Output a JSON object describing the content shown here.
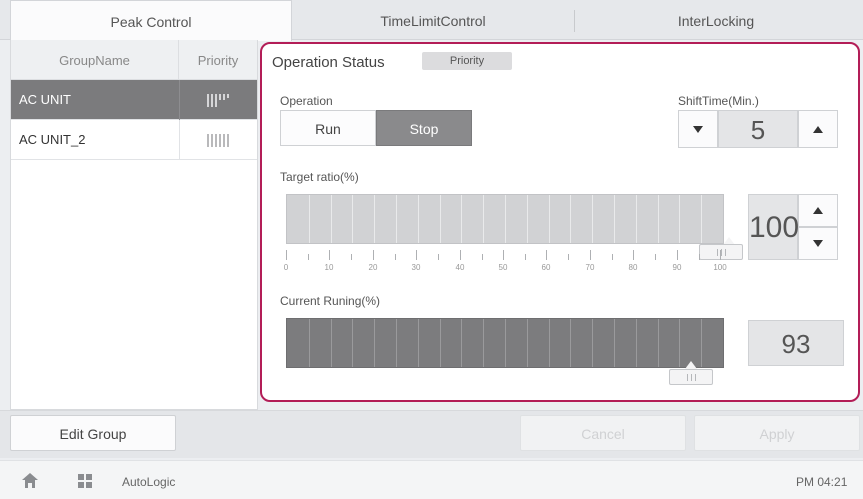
{
  "tabs": [
    {
      "label": "Peak Control",
      "active": true
    },
    {
      "label": "TimeLimitControl",
      "active": false
    },
    {
      "label": "InterLocking",
      "active": false
    }
  ],
  "group_list": {
    "header": {
      "name": "GroupName",
      "priority": "Priority"
    },
    "rows": [
      {
        "name": "AC UNIT",
        "selected": true
      },
      {
        "name": "AC UNIT_2",
        "selected": false
      }
    ]
  },
  "status_panel": {
    "title": "Operation Status",
    "priority_badge": "Priority",
    "operation_label": "Operation",
    "run_label": "Run",
    "stop_label": "Stop",
    "shift_time_label": "ShiftTime(Min.)",
    "shift_time_value": "5",
    "target_ratio_label": "Target ratio(%)",
    "target_ratio_value": "100",
    "target_ratio_ticks": [
      "0",
      "10",
      "20",
      "30",
      "40",
      "50",
      "60",
      "70",
      "80",
      "90",
      "100"
    ],
    "current_running_label": "Current Runing(%)",
    "current_running_value": "93",
    "target_ratio_level_pct": 100,
    "current_running_level_pct": 93
  },
  "actions": {
    "edit_group": "Edit Group",
    "cancel": "Cancel",
    "apply": "Apply"
  },
  "statusbar": {
    "app_name": "AutoLogic",
    "time": "PM 04:21"
  },
  "icons": {
    "home": "home-icon",
    "grid": "grid-icon"
  },
  "colors": {
    "accent_border": "#b31d57",
    "selected_row": "#7b7b7d",
    "active_segment": "#8a8a8c"
  }
}
